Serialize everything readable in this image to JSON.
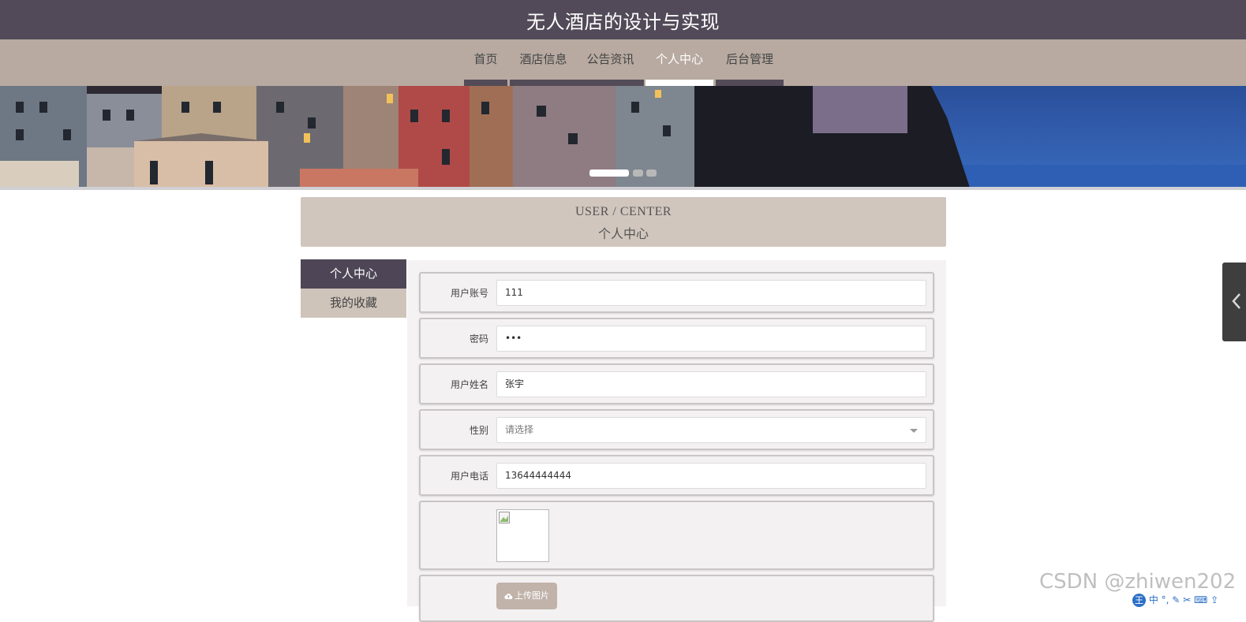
{
  "site": {
    "title": "无人酒店的设计与实现"
  },
  "nav": {
    "items": [
      {
        "label": "首页"
      },
      {
        "label": "酒店信息"
      },
      {
        "label": "公告资讯"
      },
      {
        "label": "个人中心"
      },
      {
        "label": "后台管理"
      }
    ],
    "active": "个人中心"
  },
  "banner": {
    "slide_count": 3,
    "active_slide": 1
  },
  "center": {
    "title_en": "USER / CENTER",
    "title_zh": "个人中心"
  },
  "sidebar": {
    "items": [
      {
        "label": "个人中心"
      },
      {
        "label": "我的收藏"
      }
    ]
  },
  "form": {
    "account_label": "用户账号",
    "account_value": "111",
    "password_label": "密码",
    "password_value": "•••",
    "name_label": "用户姓名",
    "name_value": "张宇",
    "gender_label": "性别",
    "gender_placeholder": "请选择",
    "phone_label": "用户电话",
    "phone_value": "13644444444",
    "upload_label": "上传图片"
  },
  "watermark": "CSDN @zhiwen202",
  "ime": {
    "logo": "王",
    "mode": "中"
  },
  "colors": {
    "header": "#524a58",
    "nav": "#b8aaa1",
    "accent": "#4e4656",
    "panel": "#d1c6bd"
  }
}
